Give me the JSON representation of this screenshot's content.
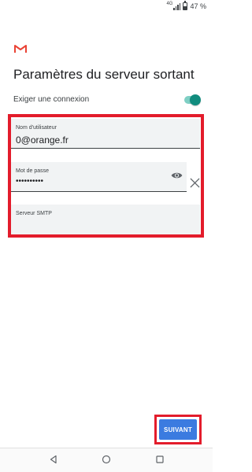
{
  "status_bar": {
    "network": "4G",
    "battery": "47 %",
    "battery_level": 0.47
  },
  "page": {
    "title": "Paramètres du serveur sortant"
  },
  "require_login": {
    "label": "Exiger une connexion",
    "enabled": true
  },
  "fields": {
    "username": {
      "label": "Nom d'utilisateur",
      "value": "0@orange.fr"
    },
    "password": {
      "label": "Mot de passe",
      "value": "••••••••••"
    },
    "smtp_server": {
      "label": "Serveur SMTP",
      "value": ""
    }
  },
  "actions": {
    "next_label": "SUIVANT"
  },
  "colors": {
    "accent": "#3b7be0",
    "toggle": "#118c7e",
    "highlight": "#e31c2b",
    "gmail_red": "#ea4335"
  },
  "icons": {
    "app_logo": "gmail-icon",
    "show_password": "eye-icon",
    "clear": "close-icon",
    "nav": [
      "back-icon",
      "home-icon",
      "recents-icon"
    ]
  }
}
